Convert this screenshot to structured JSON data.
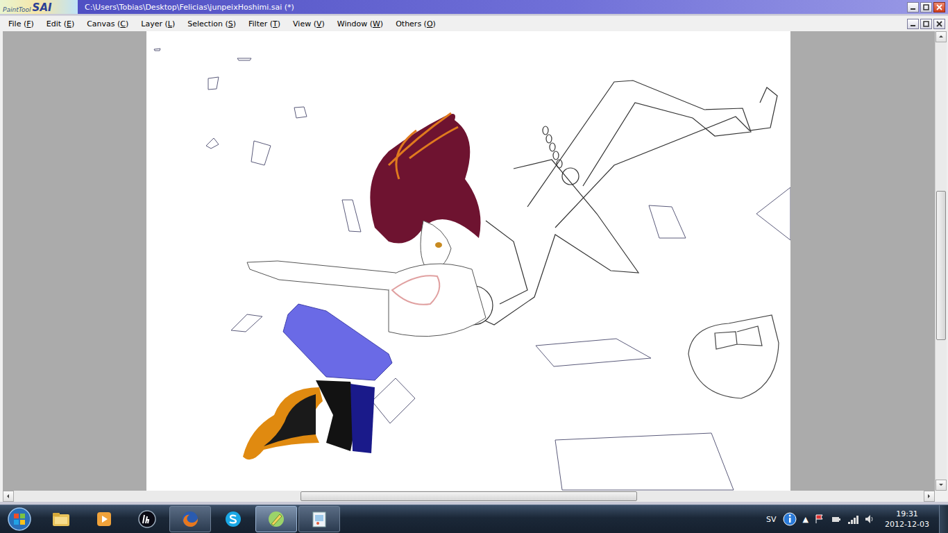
{
  "window": {
    "title": "C:\\Users\\Tobias\\Desktop\\Felicias\\junpeixHoshimi.sai (*)",
    "logo": {
      "small": "PaintTool",
      "large": "SAI"
    }
  },
  "menu": [
    {
      "label": "File (F)",
      "accelerator": "F"
    },
    {
      "label": "Edit (E)",
      "accelerator": "E"
    },
    {
      "label": "Canvas (C)",
      "accelerator": "C"
    },
    {
      "label": "Layer (L)",
      "accelerator": "L"
    },
    {
      "label": "Selection (S)",
      "accelerator": "S"
    },
    {
      "label": "Filter (T)",
      "accelerator": "T"
    },
    {
      "label": "View (V)",
      "accelerator": "V"
    },
    {
      "label": "Window (W)",
      "accelerator": "W"
    },
    {
      "label": "Others (O)",
      "accelerator": "O"
    }
  ],
  "scrollbars": {
    "vertical": {
      "position": 0.34,
      "size": 0.34
    },
    "horizontal": {
      "position": 0.315,
      "size": 0.37
    }
  },
  "taskbar": {
    "items": [
      {
        "kind": "explorer",
        "open": false,
        "selected": false
      },
      {
        "kind": "media",
        "open": false,
        "selected": false
      },
      {
        "kind": "hp",
        "open": false,
        "selected": false
      },
      {
        "kind": "firefox",
        "open": true,
        "selected": false
      },
      {
        "kind": "skype",
        "open": false,
        "selected": false
      },
      {
        "kind": "sai",
        "open": true,
        "selected": true
      },
      {
        "kind": "paint",
        "open": true,
        "selected": false
      }
    ]
  },
  "tray": {
    "language": "SV",
    "overflow": "▲",
    "time": "19:31",
    "date": "2012-12-03"
  }
}
